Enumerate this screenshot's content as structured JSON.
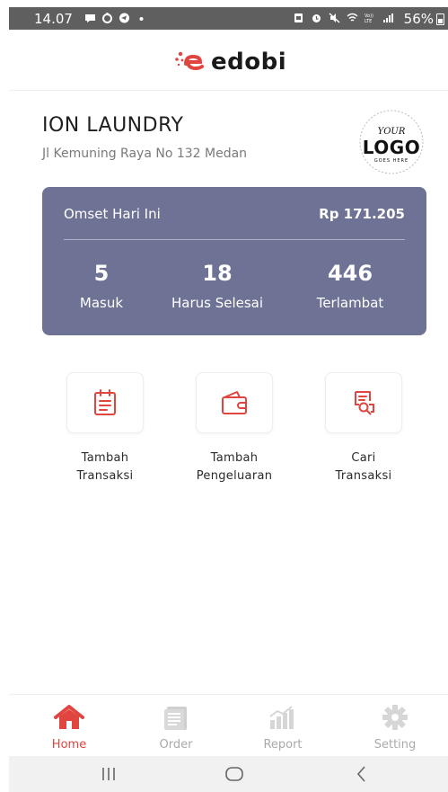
{
  "status_bar": {
    "time": "14.07",
    "battery": "56%",
    "left_icons": [
      "chat-icon",
      "steam-icon",
      "telegram-icon",
      "dot-icon"
    ],
    "right_icons": [
      "screenshot-icon",
      "alarm-icon",
      "mute-icon",
      "wifi-icon",
      "volte-icon",
      "signal-icon"
    ]
  },
  "header": {
    "brand_name": "edobi",
    "brand_color": "#e0453f"
  },
  "store": {
    "name": "ION LAUNDRY",
    "address": "Jl Kemuning Raya No 132 Medan",
    "logo": {
      "top": "YOUR",
      "main": "LOGO",
      "bottom": "GOES HERE"
    }
  },
  "summary": {
    "omset_label": "Omset Hari Ini",
    "omset_value": "Rp 171.205",
    "card_color": "#6e7294",
    "stats": [
      {
        "value": "5",
        "label": "Masuk"
      },
      {
        "value": "18",
        "label": "Harus Selesai"
      },
      {
        "value": "446",
        "label": "Terlambat"
      }
    ]
  },
  "actions": [
    {
      "line1": "Tambah",
      "line2": "Transaksi",
      "icon": "clipboard-icon"
    },
    {
      "line1": "Tambah",
      "line2": "Pengeluaran",
      "icon": "wallet-icon"
    },
    {
      "line1": "Cari",
      "line2": "Transaksi",
      "icon": "search-receipt-icon"
    }
  ],
  "bottom_nav": {
    "active_color": "#e0453f",
    "inactive_color": "#aaaaaa",
    "items": [
      {
        "label": "Home",
        "icon": "home-icon",
        "active": true
      },
      {
        "label": "Order",
        "icon": "order-icon",
        "active": false
      },
      {
        "label": "Report",
        "icon": "report-icon",
        "active": false
      },
      {
        "label": "Setting",
        "icon": "gear-icon",
        "active": false
      }
    ]
  },
  "system_nav": {
    "buttons": [
      "recent-apps-icon",
      "home-circle-icon",
      "back-icon"
    ]
  }
}
